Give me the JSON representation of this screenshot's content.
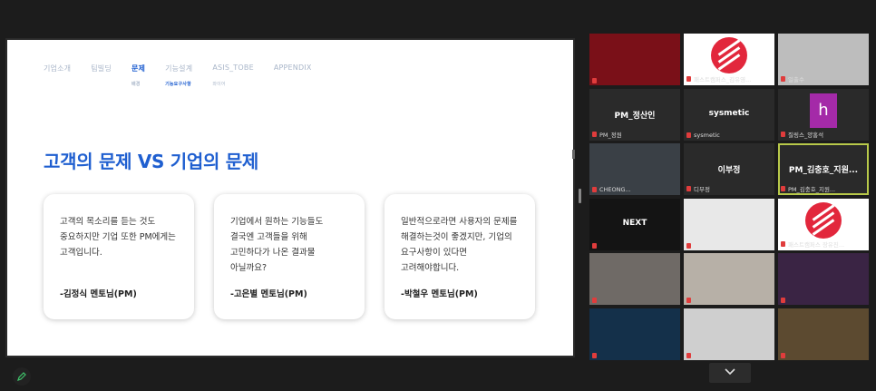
{
  "slide": {
    "nav": [
      {
        "label": "기업소개",
        "sub": "",
        "active": false
      },
      {
        "label": "팀빌딩",
        "sub": "",
        "active": false
      },
      {
        "label": "문제",
        "sub": "배경",
        "active": true
      },
      {
        "label": "기능설계",
        "sub": "기능요구사항",
        "active": false
      },
      {
        "label": "ASIS_TOBE",
        "sub": "와이어",
        "active": false
      },
      {
        "label": "APPENDIX",
        "sub": "",
        "active": false
      }
    ],
    "title": "고객의 문제 VS 기업의 문제",
    "cards": [
      {
        "text": "고객의 목소리를 듣는 것도 중요하지만 기업 또한 PM에게는 고객입니다.",
        "author": "-김정식 멘토님(PM)"
      },
      {
        "text": "기업에서 원하는 기능들도 결국엔 고객들을 위해 고민하다가 나온 결과물 아닐까요?",
        "author": "-고은별 멘토님(PM)"
      },
      {
        "text": "일반적으로라면 사용자의 문제를 해결하는것이 좋겠지만, 기업의 요구사항이 있다면 고려해야합니다.",
        "author": "-박철우 멘토님(PM)"
      }
    ]
  },
  "participants": [
    {
      "name": "",
      "label": "",
      "bg": "#7a1018"
    },
    {
      "name": "패스트캠퍼스_김유영...",
      "label": "",
      "bg": "#e2273c"
    },
    {
      "name": "일출수",
      "label": "",
      "bg": "#bdbdbd"
    },
    {
      "name": "PM_정원",
      "label": "PM_정산인",
      "bg": "#2a2a2a"
    },
    {
      "name": "sysmetic",
      "label": "sysmetic",
      "bg": "#2a2a2a"
    },
    {
      "name": "질링스_양홍석",
      "label": "h",
      "bg": "#2a2a2a"
    },
    {
      "name": "CHEONG...",
      "label": "",
      "bg": "#3a4046"
    },
    {
      "name": "디부정",
      "label": "이부정",
      "bg": "#2a2a2a"
    },
    {
      "name": "PM_김충호_지원...",
      "label": "PM_김충호_지원...",
      "bg": "#2a2a2a"
    },
    {
      "name": "",
      "label": "NEXT",
      "bg": "#141414"
    },
    {
      "name": "",
      "label": "",
      "bg": "#e8e8e8"
    },
    {
      "name": "패스트캠퍼스 장유진...",
      "label": "",
      "bg": "#e2273c"
    },
    {
      "name": "",
      "label": "",
      "bg": "#6f6a66"
    },
    {
      "name": "",
      "label": "",
      "bg": "#b7b0a7"
    },
    {
      "name": "",
      "label": "",
      "bg": "#3a2444"
    },
    {
      "name": "",
      "label": "",
      "bg": "#14304a"
    },
    {
      "name": "",
      "label": "",
      "bg": "#cfcfcf"
    },
    {
      "name": "",
      "label": "",
      "bg": "#5c4a30"
    }
  ]
}
